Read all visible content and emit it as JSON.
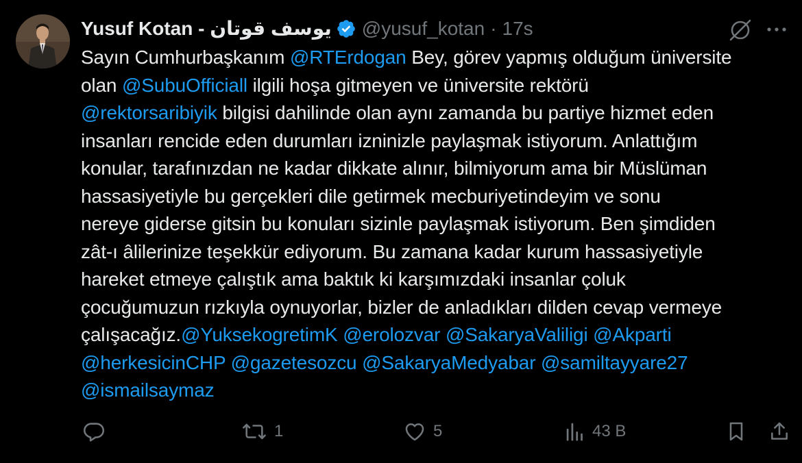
{
  "author": {
    "display_name": "Yusuf Kotan - يوسف قوتان",
    "handle": "@yusuf_kotan",
    "separator": "·",
    "time": "17s",
    "verified": true,
    "avatar": "avatar-photo"
  },
  "header_icons": {
    "grok": "grok-icon",
    "more": "more-icon"
  },
  "tweet_lines": [
    [
      {
        "t": "Sayın Cumhurbaşkanım ",
        "m": false
      },
      {
        "t": "@RTErdogan",
        "m": true
      },
      {
        "t": " Bey, görev yapmış olduğum üniversite",
        "m": false
      }
    ],
    [
      {
        "t": "olan ",
        "m": false
      },
      {
        "t": "@SubuOfficiall",
        "m": true
      },
      {
        "t": " ilgili hoşa gitmeyen ve üniversite rektörü",
        "m": false
      }
    ],
    [
      {
        "t": "@rektorsaribiyik",
        "m": true
      },
      {
        "t": " bilgisi dahilinde olan aynı zamanda bu partiye hizmet eden",
        "m": false
      }
    ],
    [
      {
        "t": "insanları rencide eden durumları izninizle paylaşmak istiyorum. Anlattığım",
        "m": false
      }
    ],
    [
      {
        "t": "konular, tarafınızdan ne kadar dikkate alınır, bilmiyorum ama bir Müslüman",
        "m": false
      }
    ],
    [
      {
        "t": "hassasiyetiyle bu gerçekleri dile getirmek mecburiyetindeyim ve sonu",
        "m": false
      }
    ],
    [
      {
        "t": "nereye giderse gitsin bu konuları sizinle paylaşmak istiyorum. Ben şimdiden",
        "m": false
      }
    ],
    [
      {
        "t": "zât-ı âlilerinize teşekkür ediyorum. Bu zamana kadar kurum hassasiyetiyle",
        "m": false
      }
    ],
    [
      {
        "t": "hareket etmeye çalıştık ama baktık ki karşımızdaki insanlar çoluk",
        "m": false
      }
    ],
    [
      {
        "t": "çocuğumuzun rızkıyla oynuyorlar, bizler de anladıkları dilden cevap vermeye",
        "m": false
      }
    ],
    [
      {
        "t": "çalışacağız.",
        "m": false
      },
      {
        "t": "@YuksekogretimK",
        "m": true
      },
      {
        "t": " ",
        "m": false
      },
      {
        "t": "@erolozvar",
        "m": true
      },
      {
        "t": " ",
        "m": false
      },
      {
        "t": "@SakaryaValiligi",
        "m": true
      },
      {
        "t": " ",
        "m": false
      },
      {
        "t": "@Akparti",
        "m": true
      }
    ],
    [
      {
        "t": "@herkesicinCHP",
        "m": true
      },
      {
        "t": " ",
        "m": false
      },
      {
        "t": "@gazetesozcu",
        "m": true
      },
      {
        "t": " ",
        "m": false
      },
      {
        "t": "@SakaryaMedyabar",
        "m": true
      },
      {
        "t": " ",
        "m": false
      },
      {
        "t": "@samiltayyare27",
        "m": true
      }
    ],
    [
      {
        "t": "@ismailsaymaz",
        "m": true
      }
    ]
  ],
  "actions": {
    "reply": {
      "icon": "reply-icon",
      "count": ""
    },
    "retweet": {
      "icon": "retweet-icon",
      "count": "1"
    },
    "like": {
      "icon": "heart-icon",
      "count": "5"
    },
    "views": {
      "icon": "views-icon",
      "count": "43 B"
    },
    "bookmark": {
      "icon": "bookmark-icon",
      "count": ""
    },
    "share": {
      "icon": "share-icon",
      "count": ""
    }
  },
  "colors": {
    "background": "#000000",
    "text": "#e7e9ea",
    "muted": "#71767b",
    "accent": "#1d9bf0"
  }
}
